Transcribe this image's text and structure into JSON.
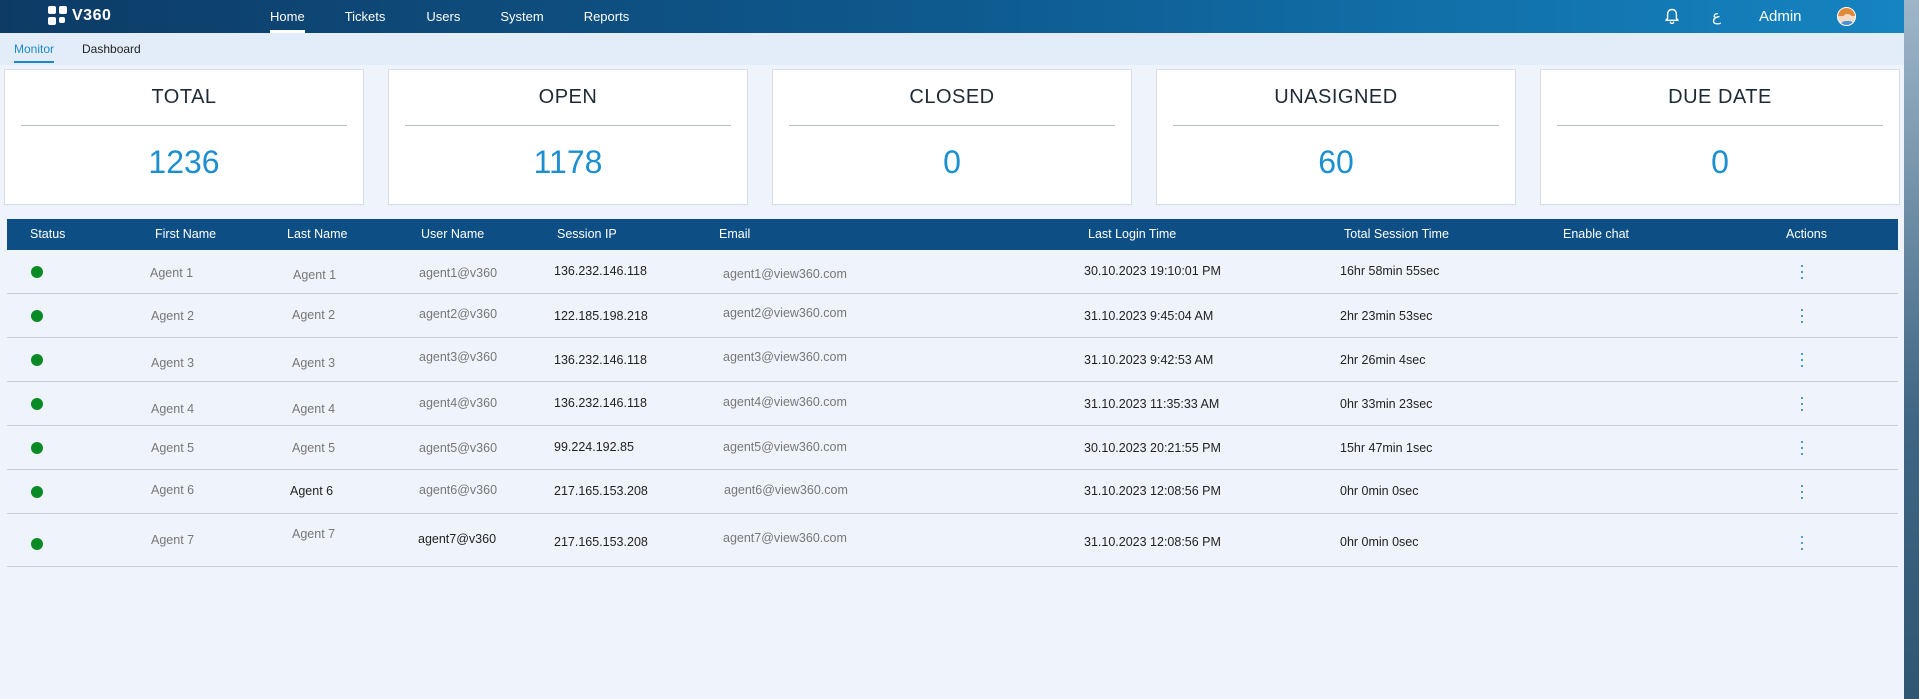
{
  "app": {
    "logo_text": "V360"
  },
  "nav": {
    "items": [
      {
        "label": "Home",
        "active": true
      },
      {
        "label": "Tickets"
      },
      {
        "label": "Users"
      },
      {
        "label": "System"
      },
      {
        "label": "Reports"
      }
    ],
    "language_toggle": "ع",
    "user_name": "Admin"
  },
  "subtabs": [
    {
      "label": "Monitor",
      "active": true
    },
    {
      "label": "Dashboard"
    }
  ],
  "stats": [
    {
      "title": "TOTAL",
      "value": "1236"
    },
    {
      "title": "OPEN",
      "value": "1178"
    },
    {
      "title": "CLOSED",
      "value": "0"
    },
    {
      "title": "UNASIGNED",
      "value": "60"
    },
    {
      "title": "DUE DATE",
      "value": "0"
    }
  ],
  "table": {
    "headers": {
      "status": "Status",
      "first_name": "First Name",
      "last_name": "Last Name",
      "user_name": "User Name",
      "session_ip": "Session IP",
      "email": "Email",
      "last_login": "Last Login Time",
      "total_session": "Total Session Time",
      "enable_chat": "Enable chat",
      "actions": "Actions"
    },
    "rows": [
      {
        "status": "online",
        "first_name": "Agent 1",
        "last_name": "Agent 1",
        "user_name": "agent1@v360",
        "session_ip": "136.232.146.118",
        "email": "agent1@view360.com",
        "last_login": "30.10.2023 19:10:01 PM",
        "total_session": "16hr 58min 55sec"
      },
      {
        "status": "online",
        "first_name": "Agent 2",
        "last_name": "Agent 2",
        "user_name": "agent2@v360",
        "session_ip": "122.185.198.218",
        "email": "agent2@view360.com",
        "last_login": "31.10.2023 9:45:04 AM",
        "total_session": "2hr 23min 53sec"
      },
      {
        "status": "online",
        "first_name": "Agent 3",
        "last_name": "Agent 3",
        "user_name": "agent3@v360",
        "session_ip": "136.232.146.118",
        "email": "agent3@view360.com",
        "last_login": "31.10.2023 9:42:53 AM",
        "total_session": "2hr 26min 4sec"
      },
      {
        "status": "online",
        "first_name": "Agent 4",
        "last_name": "Agent 4",
        "user_name": "agent4@v360",
        "session_ip": "136.232.146.118",
        "email": "agent4@view360.com",
        "last_login": "31.10.2023 11:35:33 AM",
        "total_session": "0hr 33min 23sec"
      },
      {
        "status": "online",
        "first_name": "Agent 5",
        "last_name": "Agent 5",
        "user_name": "agent5@v360",
        "session_ip": "99.224.192.85",
        "email": "agent5@view360.com",
        "last_login": "30.10.2023 20:21:55 PM",
        "total_session": "15hr 47min 1sec"
      },
      {
        "status": "online",
        "first_name": "Agent 6",
        "last_name": "Agent 6",
        "user_name": "agent6@v360",
        "session_ip": "217.165.153.208",
        "email": "agent6@view360.com",
        "last_login": "31.10.2023 12:08:56 PM",
        "total_session": "0hr 0min 0sec"
      },
      {
        "status": "online",
        "first_name": "Agent 7",
        "last_name": "Agent 7",
        "user_name": "agent7@v360",
        "session_ip": "217.165.153.208",
        "email": "agent7@view360.com",
        "last_login": "31.10.2023 12:08:56 PM",
        "total_session": "0hr 0min 0sec"
      }
    ]
  },
  "colors": {
    "nav_start": "#0d3b66",
    "nav_end": "#1584c1",
    "table_header": "#0d4f85",
    "accent": "#1c8fd0",
    "status_online": "#0a8a25"
  },
  "icons": {
    "bell": "bell-icon",
    "avatar": "avatar",
    "actions": "kebab-menu-icon",
    "logo": "logo-icon"
  }
}
